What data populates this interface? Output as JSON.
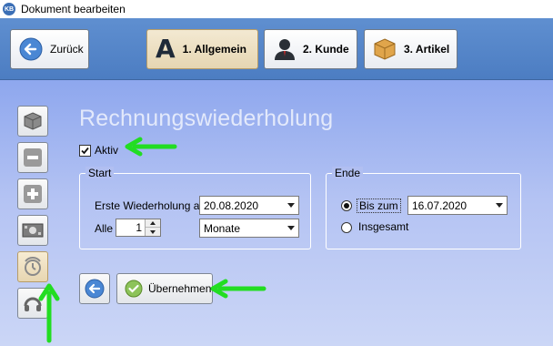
{
  "window": {
    "title": "Dokument bearbeiten",
    "icon_text": "KB"
  },
  "toolbar": {
    "back_label": "Zurück",
    "tabs": [
      {
        "label": "1. Allgemein",
        "icon": "letter-a-icon",
        "active": true
      },
      {
        "label": "2. Kunde",
        "icon": "user-icon",
        "active": false
      },
      {
        "label": "3. Artikel",
        "icon": "box-icon",
        "active": false
      }
    ]
  },
  "sidebar": [
    {
      "icon": "box-icon"
    },
    {
      "icon": "minus-icon"
    },
    {
      "icon": "plus-icon"
    },
    {
      "icon": "money-icon"
    },
    {
      "icon": "stopwatch-icon",
      "active": true
    },
    {
      "icon": "headset-icon"
    }
  ],
  "section": {
    "heading": "Rechnungswiederholung"
  },
  "aktiv": {
    "label": "Aktiv",
    "checked": true
  },
  "start": {
    "legend": "Start",
    "erste_label": "Erste Wiederholung am",
    "erste_value": "20.08.2020",
    "alle_label": "Alle",
    "alle_value": "1",
    "unit_value": "Monate"
  },
  "ende": {
    "legend": "Ende",
    "bis_label": "Bis zum",
    "bis_value": "16.07.2020",
    "bis_selected": true,
    "insgesamt_label": "Insgesamt"
  },
  "actions": {
    "apply_label": "Übernehmen"
  },
  "colors": {
    "annotation": "#22dd22",
    "toolbar": "#5a89cc"
  }
}
